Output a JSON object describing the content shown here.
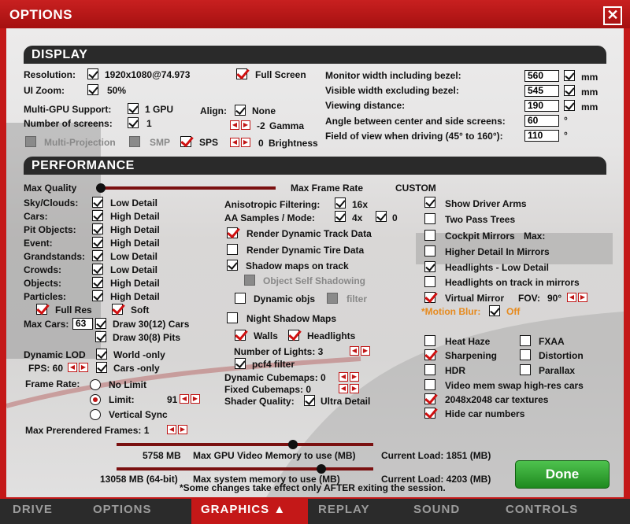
{
  "window": {
    "title": "OPTIONS",
    "close_icon": "✕"
  },
  "display": {
    "header": "DISPLAY",
    "resolution_label": "Resolution:",
    "resolution_value": "1920x1080@74.973",
    "fullscreen_label": "Full Screen",
    "uizoom_label": "UI Zoom:",
    "uizoom_value": "50%",
    "multigpu_label": "Multi-GPU Support:",
    "multigpu_value": "1 GPU",
    "screens_label": "Number of screens:",
    "screens_value": "1",
    "align_label": "Align:",
    "align_value": "None",
    "gamma_value": "-2",
    "gamma_label": "Gamma",
    "brightness_value": "0",
    "brightness_label": "Brightness",
    "multiproj_label": "Multi-Projection",
    "smp_label": "SMP",
    "sps_label": "SPS",
    "monitor_width_label": "Monitor width including bezel:",
    "monitor_width_value": "560",
    "visible_width_label": "Visible width excluding bezel:",
    "visible_width_value": "545",
    "viewing_distance_label": "Viewing distance:",
    "viewing_distance_value": "190",
    "unit_mm": "mm",
    "angle_label": "Angle between center and side screens:",
    "angle_value": "60",
    "fov_label": "Field of view when driving (45° to 160°):",
    "fov_value": "110",
    "degree": "°"
  },
  "performance": {
    "header": "PERFORMANCE",
    "max_quality": "Max Quality",
    "max_framerate": "Max Frame Rate",
    "custom": "CUSTOM",
    "quality_slider_level": 0,
    "rows": [
      {
        "label": "Sky/Clouds:",
        "value": "Low Detail"
      },
      {
        "label": "Cars:",
        "value": "High Detail"
      },
      {
        "label": "Pit Objects:",
        "value": "High Detail"
      },
      {
        "label": "Event:",
        "value": "High Detail"
      },
      {
        "label": "Grandstands:",
        "value": "Low Detail"
      },
      {
        "label": "Crowds:",
        "value": "Low Detail"
      },
      {
        "label": "Objects:",
        "value": "High Detail"
      },
      {
        "label": "Particles:",
        "value": "High Detail"
      }
    ],
    "full_res": "Full Res",
    "soft": "Soft",
    "max_cars_label": "Max Cars:",
    "max_cars_value": "63",
    "draw_cars": "Draw 30(12) Cars",
    "draw_pits": "Draw 30(8) Pits",
    "dynamic_lod_label": "Dynamic LOD",
    "dynamic_lod_value": "World -only",
    "fps_label": "FPS: 60",
    "cars_only": "Cars -only",
    "frame_rate_label": "Frame Rate:",
    "no_limit": "No Limit",
    "limit": "Limit:",
    "limit_value": "91",
    "vsync": "Vertical Sync",
    "prerendered": "Max Prerendered Frames: 1",
    "aniso_label": "Anisotropic Filtering:",
    "aniso_value": "16x",
    "aa_label": "AA Samples / Mode:",
    "aa_samples": "4x",
    "aa_mode": "0",
    "render_track": "Render Dynamic Track Data",
    "render_tire": "Render Dynamic Tire Data",
    "shadow_track": "Shadow maps on track",
    "object_self_shadow": "Object Self Shadowing",
    "dynamic_objs": "Dynamic objs",
    "filter": "filter",
    "night_shadow": "Night Shadow Maps",
    "walls": "Walls",
    "headlights": "Headlights",
    "num_lights": "Number of Lights: 3",
    "pcf4": "pcf4 filter",
    "dyn_cubemaps": "Dynamic Cubemaps: 0",
    "fixed_cubemaps": "Fixed Cubemaps: 0",
    "shader_quality_label": "Shader Quality:",
    "shader_quality_value": "Ultra Detail",
    "show_arms": "Show Driver Arms",
    "two_pass": "Two Pass Trees",
    "cockpit_mirrors": "Cockpit Mirrors",
    "max": "Max:",
    "higher_detail_mirrors": "Higher Detail In Mirrors",
    "headlights_low": "Headlights - Low Detail",
    "headlights_track_mirrors": "Headlights on track in mirrors",
    "virtual_mirror": "Virtual Mirror",
    "fov_label2": "FOV:",
    "fov_value2": "90°",
    "motion_blur": "*Motion Blur:",
    "motion_blur_value": "Off",
    "heat_haze": "Heat Haze",
    "fxaa": "FXAA",
    "sharpening": "Sharpening",
    "distortion": "Distortion",
    "hdr": "HDR",
    "parallax": "Parallax",
    "video_swap": "Video mem swap high-res cars",
    "car_textures": "2048x2048 car textures",
    "hide_numbers": "Hide car numbers",
    "gpu_mem_value": "5758 MB",
    "gpu_mem_label": "Max GPU Video Memory to use (MB)",
    "gpu_load": "Current Load: 1851 (MB)",
    "sys_mem_value": "13058 MB (64-bit)",
    "sys_mem_label": "Max system memory to use (MB)",
    "sys_load": "Current Load: 4203 (MB)",
    "note": "*Some changes take effect only AFTER exiting the session.",
    "done": "Done"
  },
  "tabs": [
    "DRIVE",
    "OPTIONS",
    "GRAPHICS ▲",
    "REPLAY",
    "SOUND",
    "CONTROLS"
  ],
  "colors": {
    "accent": "#c41818",
    "done": "#2ea02e",
    "orange": "#e68a1e"
  }
}
